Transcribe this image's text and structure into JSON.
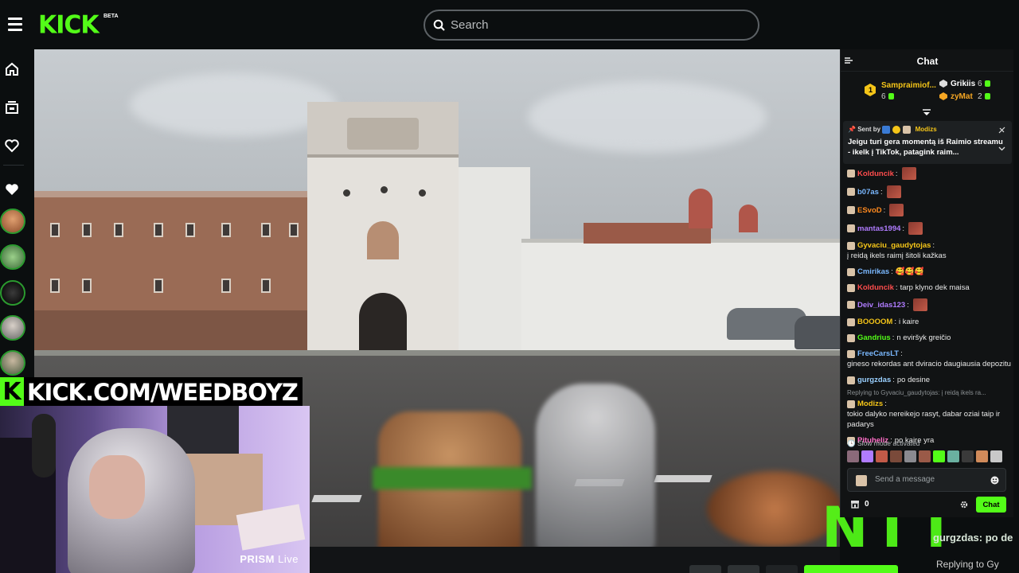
{
  "header": {
    "logo": "KICK",
    "logo_badge": "BETA",
    "search_placeholder": "Search"
  },
  "sidebar": {
    "icons": [
      "home-icon",
      "following-icon",
      "heart-icon"
    ],
    "section_icon": "heart-icon"
  },
  "stream": {
    "overlay_url": "KICK.COM/WEEDBOYZ",
    "overlay_k": "K",
    "prism_brand": "PRISM",
    "prism_suffix": "Live",
    "corner_logo": "NTT"
  },
  "chat": {
    "title": "Chat",
    "leaderboard": [
      {
        "rank": "1",
        "name": "Sampraimiof...",
        "count": "6",
        "color": "#f5c518"
      },
      {
        "name": "Grikiis",
        "count": "6",
        "color": "#ffffff"
      },
      {
        "name": "zyMat",
        "count": "2",
        "color": "#f5a623"
      }
    ],
    "pinned": {
      "sent_by_label": "Sent by",
      "author": "Modizs",
      "message": "Jeigu turi gera momentą iš Raimio streamu - ikelk į TikTok, patagink raim..."
    },
    "messages": [
      {
        "user": "Kolduncik",
        "color": "#ff4d4d",
        "text": "",
        "emote": true
      },
      {
        "user": "b07as",
        "color": "#7ab8ff",
        "text": "",
        "emote": true
      },
      {
        "user": "ESvoD",
        "color": "#ff8a1f",
        "text": "",
        "emote": true
      },
      {
        "user": "mantas1994",
        "color": "#b07cff",
        "text": "",
        "emote": true
      },
      {
        "user": "Gyvaciu_gaudytojas",
        "color": "#f5c518",
        "text": "į reidą ikels raimį šitoli kažkas",
        "emote": false
      },
      {
        "user": "Cmirikas",
        "color": "#7ab8ff",
        "text": "🥰🥰🥰",
        "emote": false
      },
      {
        "user": "Kolduncik",
        "color": "#ff4d4d",
        "text": "tarp klyno dek maisa",
        "emote": false
      },
      {
        "user": "Deiv_idas123",
        "color": "#b07cff",
        "text": "",
        "emote": true
      },
      {
        "user": "BOOOOM",
        "color": "#f5c518",
        "text": "i kaire",
        "emote": false
      },
      {
        "user": "Gandrius",
        "color": "#53fc18",
        "text": "n eviršyk greičio",
        "emote": false
      },
      {
        "user": "FreeCarsLT",
        "color": "#7ab8ff",
        "text": "gineso rekordas ant dviracio daugiausia depozitu",
        "emote": false
      },
      {
        "user": "gurgzdas",
        "color": "#9ad0ff",
        "text": "po desine",
        "emote": false
      },
      {
        "reply": "Replying to Gyvaciu_gaudytojas: į reidą ikels ra...",
        "user": "Modizs",
        "color": "#f5c518",
        "text": "tokio dalyko nereikejo rasyt, dabar oziai taip ir padarys",
        "emote": false
      },
      {
        "user": "Pituheliz",
        "color": "#ff6ec7",
        "text": "po kaire yra",
        "emote": false
      }
    ],
    "slow_mode": "Slow mode activated",
    "input_placeholder": "Send a message",
    "points": "0",
    "send_label": "Chat"
  },
  "bleed": {
    "line1": "gurgzdas: po de",
    "line2": "Replying to Gy"
  },
  "colors": {
    "brand": "#53fc18",
    "bg": "#0b0e0f",
    "chat_bg": "#111314"
  }
}
